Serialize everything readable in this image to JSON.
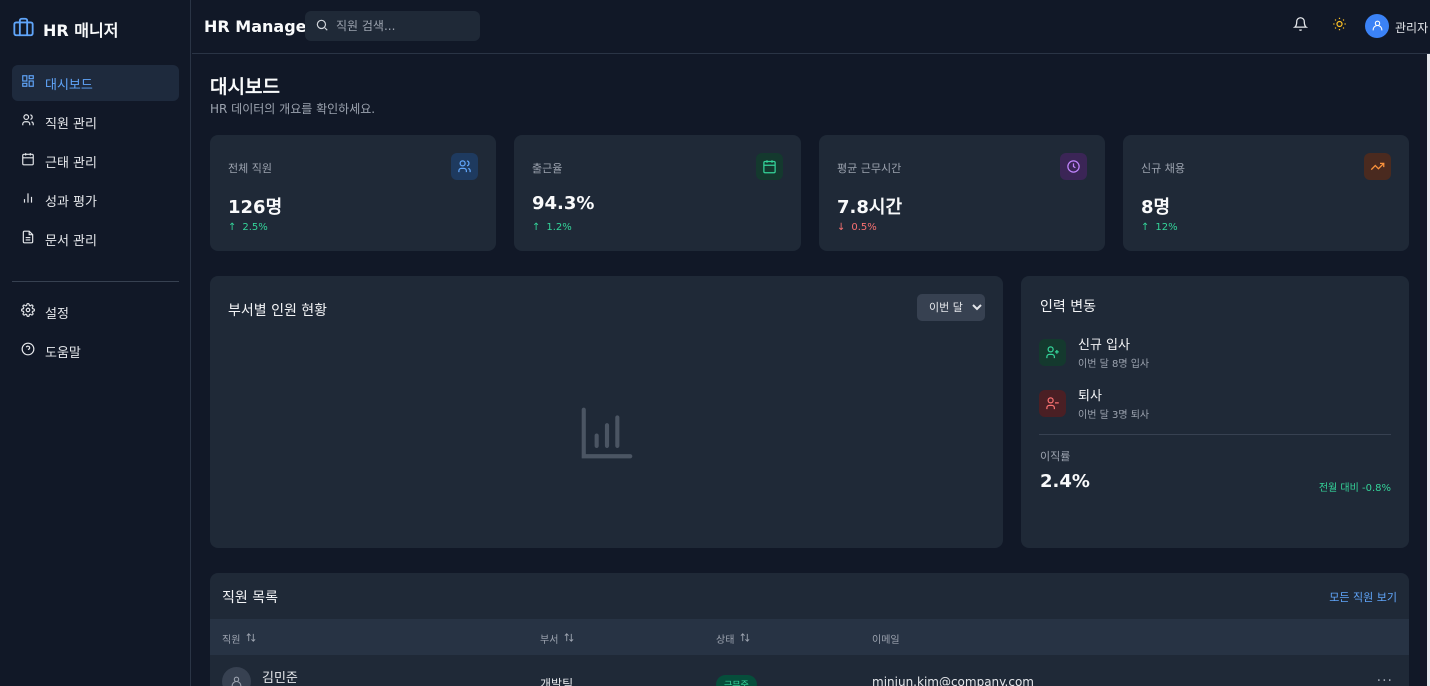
{
  "sidebar": {
    "brand": "HR 매니저",
    "items": [
      {
        "label": "대시보드",
        "icon": "dashboard-icon"
      },
      {
        "label": "직원 관리",
        "icon": "users-icon"
      },
      {
        "label": "근태 관리",
        "icon": "calendar-icon"
      },
      {
        "label": "성과 평가",
        "icon": "bar-chart-icon"
      },
      {
        "label": "문서 관리",
        "icon": "document-icon"
      }
    ],
    "bottom_items": [
      {
        "label": "설정",
        "icon": "gear-icon"
      },
      {
        "label": "도움말",
        "icon": "help-icon"
      }
    ]
  },
  "header": {
    "title": "HR Manager",
    "search_placeholder": "직원 검색...",
    "user_name": "관리자"
  },
  "page": {
    "title": "대시보드",
    "subtitle": "HR 데이터의 개요를 확인하세요."
  },
  "stats": [
    {
      "label": "전체 직원",
      "value": "126명",
      "change": "2.5%",
      "direction": "up",
      "icon": "users-icon",
      "accent": "#60a5fa"
    },
    {
      "label": "출근율",
      "value": "94.3%",
      "change": "1.2%",
      "direction": "up",
      "icon": "calendar-icon",
      "accent": "#34d399"
    },
    {
      "label": "평균 근무시간",
      "value": "7.8시간",
      "change": "0.5%",
      "direction": "down",
      "icon": "clock-icon",
      "accent": "#c084fc"
    },
    {
      "label": "신규 채용",
      "value": "8명",
      "change": "12%",
      "direction": "up",
      "icon": "trending-up-icon",
      "accent": "#fb923c"
    }
  ],
  "department_chart": {
    "title": "부서별 인원 현황",
    "period_selected": "이번 달"
  },
  "workforce": {
    "title": "인력 변동",
    "new_hire_title": "신규 입사",
    "new_hire_desc": "이번 달 8명 입사",
    "leave_title": "퇴사",
    "leave_desc": "이번 달 3명 퇴사",
    "turnover_label": "이직률",
    "turnover_value": "2.4%",
    "turnover_compare": "전월 대비 -0.8%"
  },
  "employee_table": {
    "title": "직원 목록",
    "view_all": "모든 직원 보기",
    "columns": [
      "직원",
      "부서",
      "상태",
      "이메일"
    ],
    "rows": [
      {
        "name": "김민준",
        "department": "개발팀",
        "status": "근무중",
        "email": "minjun.kim@company.com",
        "menu": "···"
      }
    ]
  },
  "colors": {
    "background": "#111827",
    "card": "#1f2937",
    "accent_blue": "#60a5fa",
    "positive": "#34d399",
    "negative": "#f87171"
  }
}
